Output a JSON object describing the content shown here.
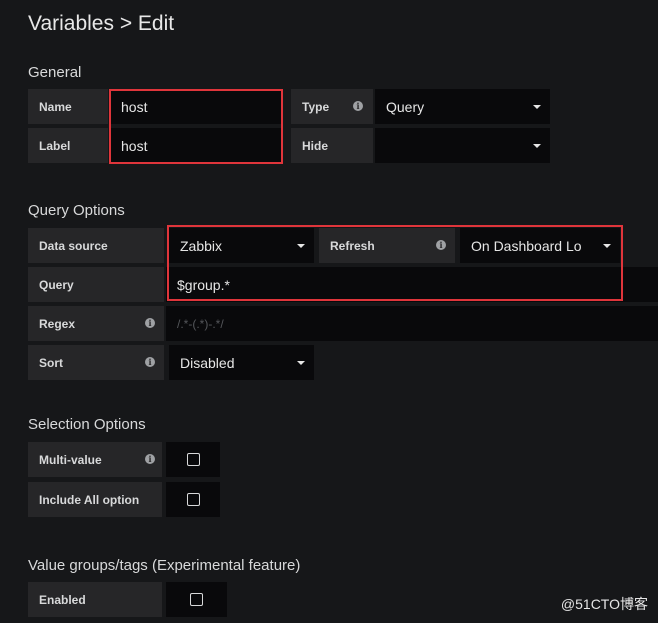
{
  "header": {
    "title": "Variables > Edit"
  },
  "general": {
    "heading": "General",
    "name_label": "Name",
    "name_value": "host",
    "label_label": "Label",
    "label_value": "host",
    "type_label": "Type",
    "type_value": "Query",
    "hide_label": "Hide",
    "hide_value": ""
  },
  "query_options": {
    "heading": "Query Options",
    "datasource_label": "Data source",
    "datasource_value": "Zabbix",
    "refresh_label": "Refresh",
    "refresh_value": "On Dashboard Lo",
    "query_label": "Query",
    "query_value": "$group.*",
    "regex_label": "Regex",
    "regex_placeholder": "/.*-(.*)-.*/",
    "sort_label": "Sort",
    "sort_value": "Disabled"
  },
  "selection_options": {
    "heading": "Selection Options",
    "multi_label": "Multi-value",
    "multi_checked": false,
    "includeall_label": "Include All option",
    "includeall_checked": false
  },
  "value_groups": {
    "heading": "Value groups/tags (Experimental feature)",
    "enabled_label": "Enabled",
    "enabled_checked": false
  },
  "watermark": "@51CTO博客",
  "icons": {
    "info": "info-icon",
    "caret": "caret-down-icon",
    "checkbox": "checkbox-icon"
  },
  "colors": {
    "background": "#161719",
    "label_bg": "#262628",
    "field_bg": "#09090b",
    "highlight": "#e0353b"
  }
}
